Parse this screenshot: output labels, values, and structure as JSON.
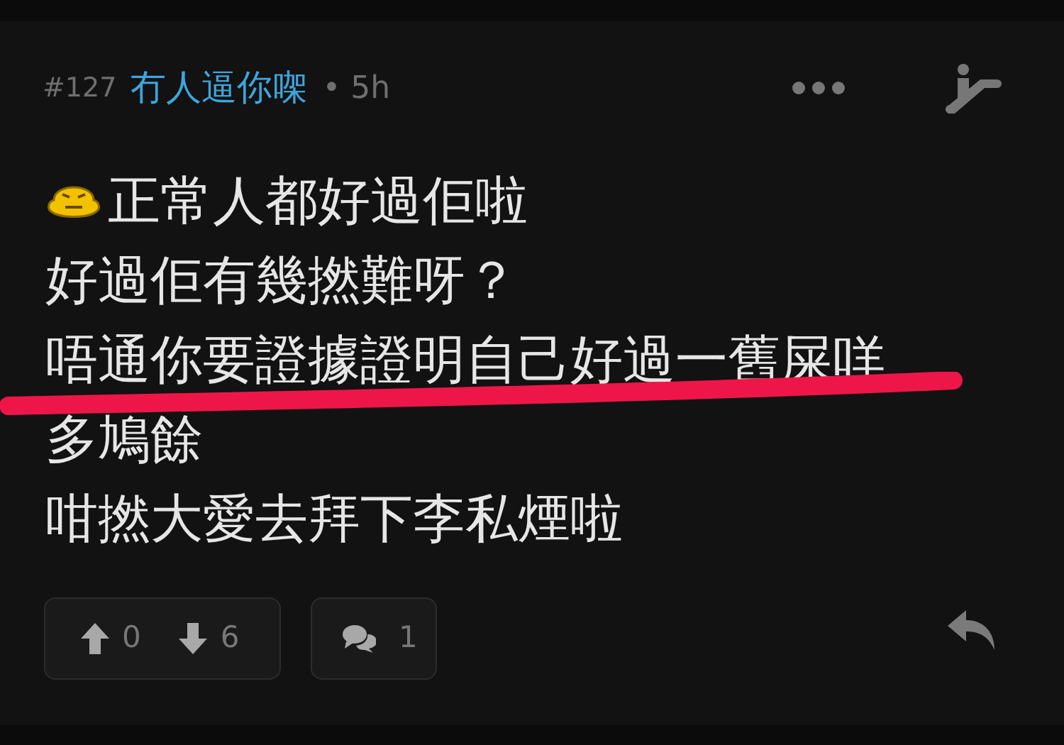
{
  "post": {
    "number": "#127",
    "author": "冇人逼你㗎",
    "time": "• 5h"
  },
  "lines": [
    {
      "text": "正常人都好過佢啦",
      "emoji": true
    },
    {
      "text": "好過佢有幾撚難呀？",
      "emoji": false
    },
    {
      "text": "唔通你要證據證明自己好過一舊屎咩",
      "emoji": false
    },
    {
      "text": "多鳩餘",
      "emoji": false
    },
    {
      "text": "咁撚大愛去拜下李私煙啦",
      "emoji": false
    }
  ],
  "votes": {
    "up": "0",
    "down": "6"
  },
  "comments": "1"
}
